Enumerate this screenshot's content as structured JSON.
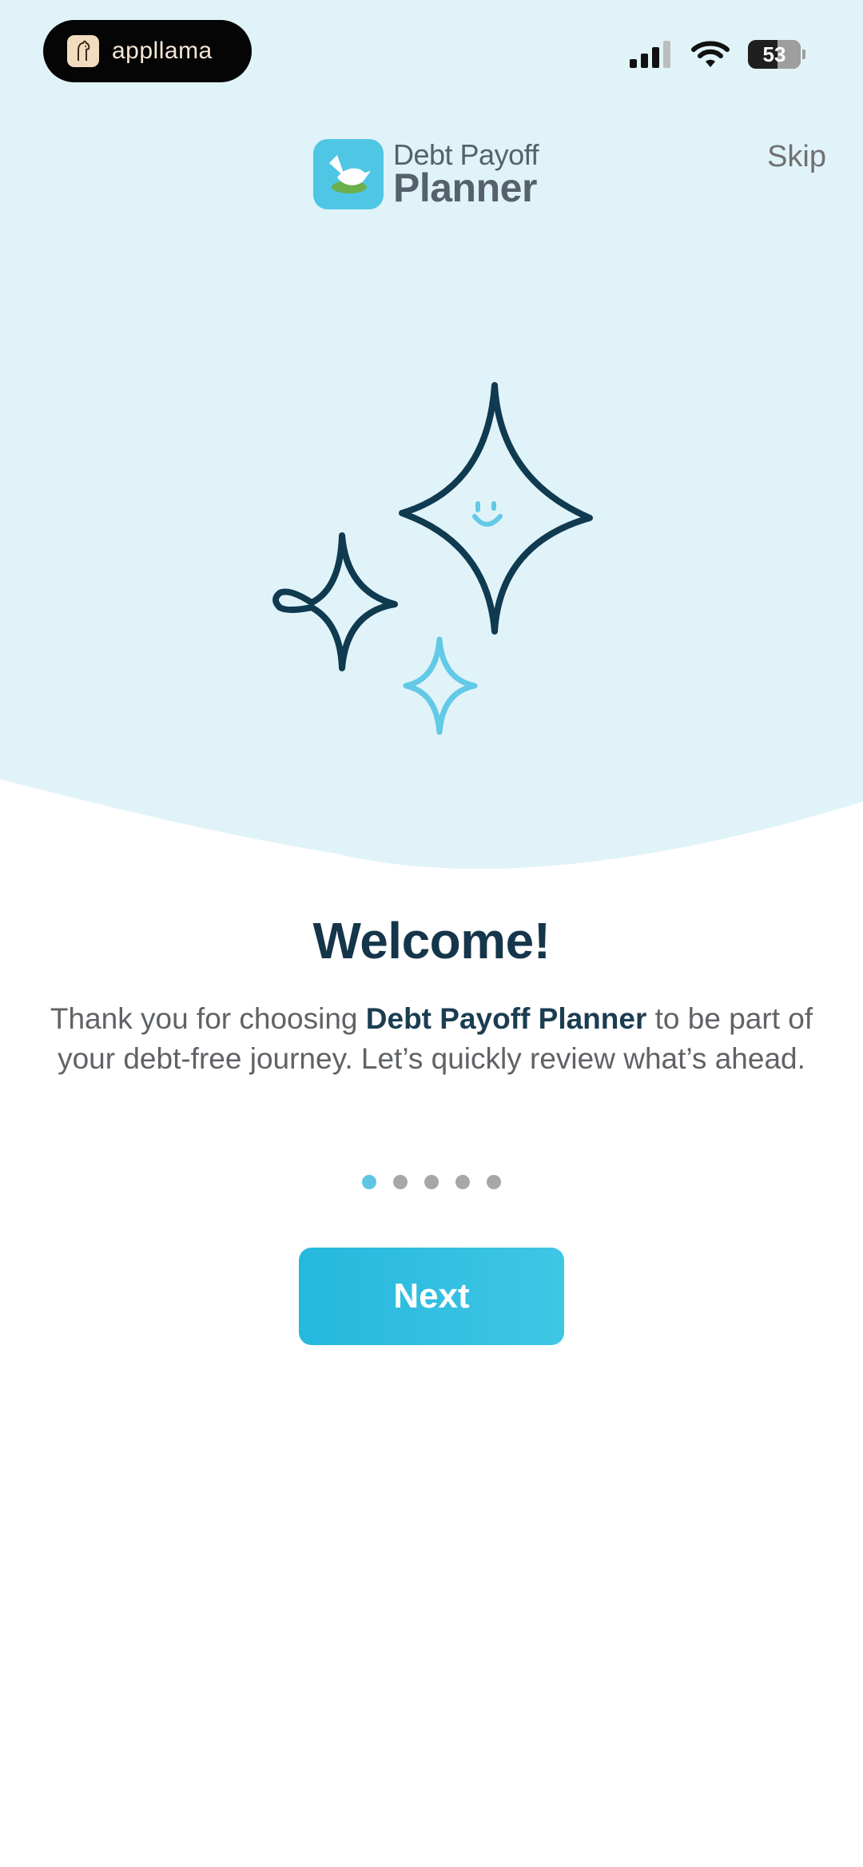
{
  "status_bar": {
    "recording_app_name": "appllama",
    "battery_level": "53"
  },
  "brand": {
    "line1": "Debt Payoff",
    "line2": "Planner"
  },
  "header": {
    "skip_label": "Skip"
  },
  "onboarding": {
    "title": "Welcome!",
    "description_prefix": "Thank you for choosing ",
    "description_bold": "Debt Payoff Planner",
    "description_suffix": " to be part of your debt-free journey. Let’s quickly review what’s ahead.",
    "total_steps": 5,
    "current_step": 1,
    "next_label": "Next"
  },
  "colors": {
    "hero_background": "#e0f3f9",
    "accent": "#2ab9de",
    "dark_navy": "#0f3a50",
    "light_blue": "#62c9e6"
  },
  "icons": [
    "appllama-logo-icon",
    "cellular-signal-icon",
    "wifi-icon",
    "battery-icon",
    "dove-app-icon",
    "sparkle-stars-illustration"
  ]
}
